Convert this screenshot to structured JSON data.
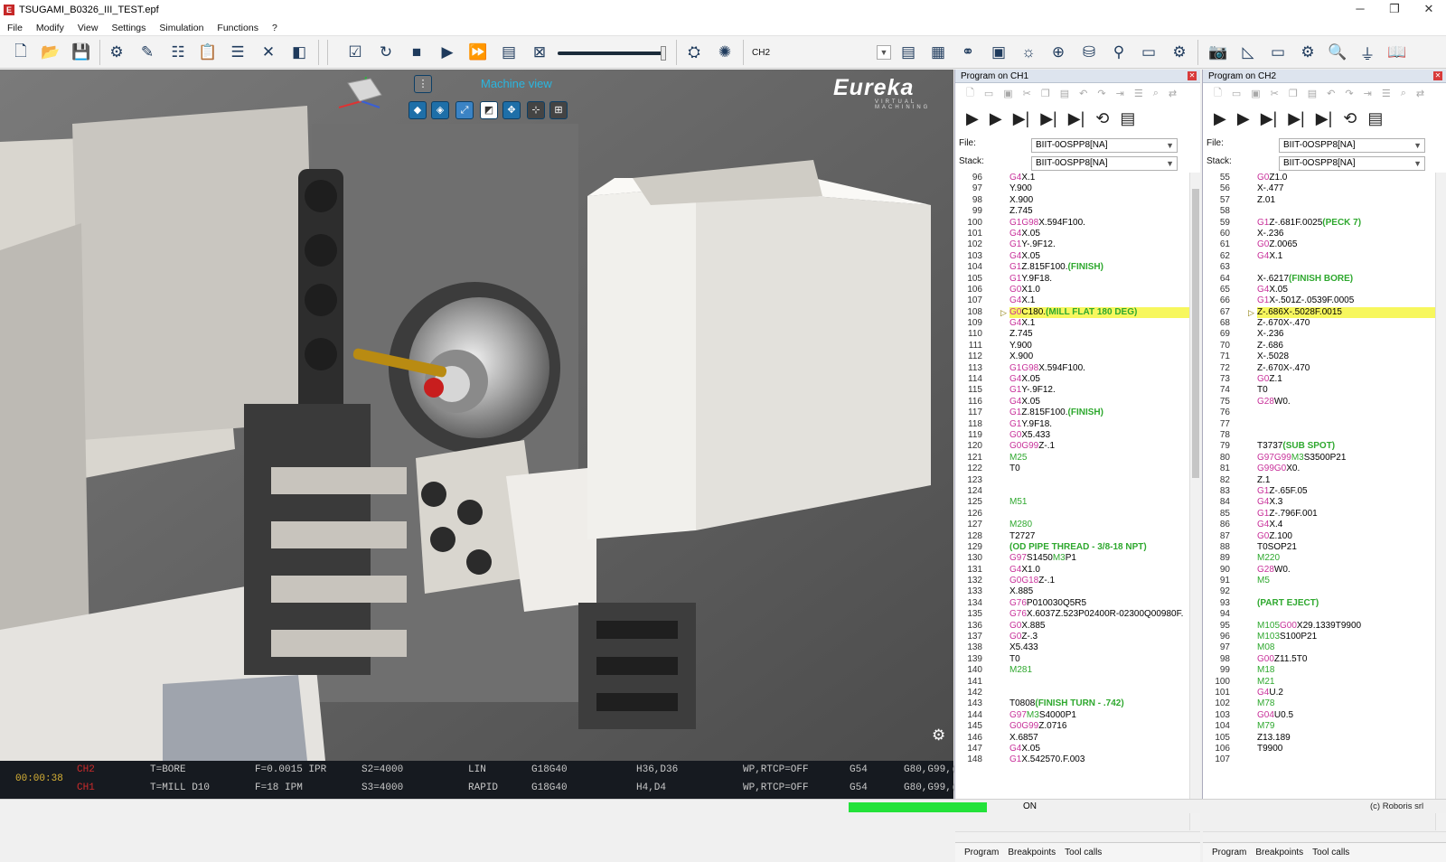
{
  "window": {
    "title": "TSUGAMI_B0326_III_TEST.epf",
    "controls": [
      "─",
      "❐",
      "✕"
    ]
  },
  "menu": [
    "File",
    "Modify",
    "View",
    "Settings",
    "Simulation",
    "Functions",
    "?"
  ],
  "toolbar": {
    "channel": "CH2"
  },
  "viewport": {
    "view_label": "Machine view",
    "brand": "Eureka",
    "brand_sub": "VIRTUAL MACHINING"
  },
  "status": {
    "time": "00:00:38",
    "rows": [
      {
        "ch": "CH2",
        "tool": "T=BORE",
        "feed": "F=0.0015 IPR",
        "speed": "S2=4000",
        "mode": "LIN",
        "g1": "G18G40",
        "hd": "H36,D36",
        "wp": "WP,RTCP=OFF",
        "wcs": "G54",
        "g2": "G80,G99,("
      },
      {
        "ch": "CH1",
        "tool": "T=MILL D10",
        "feed": "F=18 IPM",
        "speed": "S3=4000",
        "mode": "RAPID",
        "g1": "G18G40",
        "hd": "H4,D4",
        "wp": "WP,RTCP=OFF",
        "wcs": "G54",
        "g2": "G80,G99,("
      }
    ]
  },
  "panel1": {
    "title": "Program on CH1",
    "file_label": "File:",
    "stack_label": "Stack:",
    "file": "BIIT-0OSPP8[NA]",
    "stack": "BIIT-0OSPP8[NA]",
    "tabs": [
      "Program",
      "Breakpoints",
      "Tool calls"
    ],
    "lines": [
      {
        "n": "96",
        "s": [
          [
            "G4",
            "g"
          ],
          [
            "X.1",
            "n"
          ]
        ]
      },
      {
        "n": "97",
        "s": [
          [
            "Y.900",
            "n"
          ]
        ]
      },
      {
        "n": "98",
        "s": [
          [
            "X.900",
            "n"
          ]
        ]
      },
      {
        "n": "99",
        "s": [
          [
            "Z.745",
            "n"
          ]
        ]
      },
      {
        "n": "100",
        "s": [
          [
            "G1",
            "g"
          ],
          [
            "G98",
            "g"
          ],
          [
            "X.594F100.",
            "n"
          ]
        ]
      },
      {
        "n": "101",
        "s": [
          [
            "G4",
            "g"
          ],
          [
            "X.05",
            "n"
          ]
        ]
      },
      {
        "n": "102",
        "s": [
          [
            "G1",
            "g"
          ],
          [
            "Y-.9F12.",
            "n"
          ]
        ]
      },
      {
        "n": "103",
        "s": [
          [
            "G4",
            "g"
          ],
          [
            "X.05",
            "n"
          ]
        ]
      },
      {
        "n": "104",
        "s": [
          [
            "G1",
            "g"
          ],
          [
            "Z.815F100.",
            "n"
          ],
          [
            "(FINISH)",
            "c"
          ]
        ]
      },
      {
        "n": "105",
        "s": [
          [
            "G1",
            "g"
          ],
          [
            "Y.9F18.",
            "n"
          ]
        ]
      },
      {
        "n": "106",
        "s": [
          [
            "G0",
            "g"
          ],
          [
            "X1.0",
            "n"
          ]
        ]
      },
      {
        "n": "107",
        "s": [
          [
            "G4",
            "g"
          ],
          [
            "X.1",
            "n"
          ]
        ]
      },
      {
        "n": "108",
        "hl": true,
        "s": [
          [
            "G0",
            "g"
          ],
          [
            "C180.",
            "n"
          ],
          [
            "(MILL FLAT 180 DEG)",
            "c"
          ]
        ]
      },
      {
        "n": "109",
        "s": [
          [
            "G4",
            "g"
          ],
          [
            "X.1",
            "n"
          ]
        ]
      },
      {
        "n": "110",
        "s": [
          [
            "Z.745",
            "n"
          ]
        ]
      },
      {
        "n": "111",
        "s": [
          [
            "Y.900",
            "n"
          ]
        ]
      },
      {
        "n": "112",
        "s": [
          [
            "X.900",
            "n"
          ]
        ]
      },
      {
        "n": "113",
        "s": [
          [
            "G1",
            "g"
          ],
          [
            "G98",
            "g"
          ],
          [
            "X.594F100.",
            "n"
          ]
        ]
      },
      {
        "n": "114",
        "s": [
          [
            "G4",
            "g"
          ],
          [
            "X.05",
            "n"
          ]
        ]
      },
      {
        "n": "115",
        "s": [
          [
            "G1",
            "g"
          ],
          [
            "Y-.9F12.",
            "n"
          ]
        ]
      },
      {
        "n": "116",
        "s": [
          [
            "G4",
            "g"
          ],
          [
            "X.05",
            "n"
          ]
        ]
      },
      {
        "n": "117",
        "s": [
          [
            "G1",
            "g"
          ],
          [
            "Z.815F100.",
            "n"
          ],
          [
            "(FINISH)",
            "c"
          ]
        ]
      },
      {
        "n": "118",
        "s": [
          [
            "G1",
            "g"
          ],
          [
            "Y.9F18.",
            "n"
          ]
        ]
      },
      {
        "n": "119",
        "s": [
          [
            "G0",
            "g"
          ],
          [
            "X5.433",
            "n"
          ]
        ]
      },
      {
        "n": "120",
        "s": [
          [
            "G0",
            "g"
          ],
          [
            "G99",
            "g"
          ],
          [
            "Z-.1",
            "n"
          ]
        ]
      },
      {
        "n": "121",
        "s": [
          [
            "M25",
            "m"
          ]
        ]
      },
      {
        "n": "122",
        "s": [
          [
            "T0",
            "n"
          ]
        ]
      },
      {
        "n": "123",
        "s": []
      },
      {
        "n": "124",
        "s": []
      },
      {
        "n": "125",
        "s": [
          [
            "M51",
            "m"
          ]
        ]
      },
      {
        "n": "126",
        "s": []
      },
      {
        "n": "127",
        "s": [
          [
            "M280",
            "m"
          ]
        ]
      },
      {
        "n": "128",
        "s": [
          [
            "T2727",
            "n"
          ]
        ]
      },
      {
        "n": "129",
        "s": [
          [
            "(OD PIPE THREAD - 3/8-18 NPT)",
            "c"
          ]
        ]
      },
      {
        "n": "130",
        "s": [
          [
            "G97",
            "g"
          ],
          [
            "S1450",
            "n"
          ],
          [
            "M3",
            "m"
          ],
          [
            "P1",
            "n"
          ]
        ]
      },
      {
        "n": "131",
        "s": [
          [
            "G4",
            "g"
          ],
          [
            "X1.0",
            "n"
          ]
        ]
      },
      {
        "n": "132",
        "s": [
          [
            "G0",
            "g"
          ],
          [
            "G18",
            "g"
          ],
          [
            "Z-.1",
            "n"
          ]
        ]
      },
      {
        "n": "133",
        "s": [
          [
            "X.885",
            "n"
          ]
        ]
      },
      {
        "n": "134",
        "s": [
          [
            "G76",
            "g"
          ],
          [
            "P010030Q5R5",
            "n"
          ]
        ]
      },
      {
        "n": "135",
        "s": [
          [
            "G76",
            "g"
          ],
          [
            "X.6037Z.523P02400R-02300Q00980F.",
            "n"
          ]
        ]
      },
      {
        "n": "136",
        "s": [
          [
            "G0",
            "g"
          ],
          [
            "X.885",
            "n"
          ]
        ]
      },
      {
        "n": "137",
        "s": [
          [
            "G0",
            "g"
          ],
          [
            "Z-.3",
            "n"
          ]
        ]
      },
      {
        "n": "138",
        "s": [
          [
            "X5.433",
            "n"
          ]
        ]
      },
      {
        "n": "139",
        "s": [
          [
            "T0",
            "n"
          ]
        ]
      },
      {
        "n": "140",
        "s": [
          [
            "M281",
            "m"
          ]
        ]
      },
      {
        "n": "141",
        "s": []
      },
      {
        "n": "142",
        "s": []
      },
      {
        "n": "143",
        "s": [
          [
            "T0808",
            "n"
          ],
          [
            "(FINISH TURN - .742)",
            "c"
          ]
        ]
      },
      {
        "n": "144",
        "s": [
          [
            "G97",
            "g"
          ],
          [
            "M3",
            "m"
          ],
          [
            "S4000P1",
            "n"
          ]
        ]
      },
      {
        "n": "145",
        "s": [
          [
            "G0",
            "g"
          ],
          [
            "G99",
            "g"
          ],
          [
            "Z.0716",
            "n"
          ]
        ]
      },
      {
        "n": "146",
        "s": [
          [
            "X.6857",
            "n"
          ]
        ]
      },
      {
        "n": "147",
        "s": [
          [
            "G4",
            "g"
          ],
          [
            "X.05",
            "n"
          ]
        ]
      },
      {
        "n": "148",
        "s": [
          [
            "G1",
            "g"
          ],
          [
            "X.542570.F.003",
            "n"
          ]
        ]
      }
    ]
  },
  "panel2": {
    "title": "Program on CH2",
    "file_label": "File:",
    "stack_label": "Stack:",
    "file": "BIIT-0OSPP8[NA]",
    "stack": "BIIT-0OSPP8[NA]",
    "tabs": [
      "Program",
      "Breakpoints",
      "Tool calls"
    ],
    "lines": [
      {
        "n": "55",
        "s": [
          [
            "G0",
            "g"
          ],
          [
            "Z1.0",
            "n"
          ]
        ]
      },
      {
        "n": "56",
        "s": [
          [
            "X-.477",
            "n"
          ]
        ]
      },
      {
        "n": "57",
        "s": [
          [
            "Z.01",
            "n"
          ]
        ]
      },
      {
        "n": "58",
        "s": []
      },
      {
        "n": "59",
        "s": [
          [
            "G1",
            "g"
          ],
          [
            "Z-.681F.0025",
            "n"
          ],
          [
            "(PECK 7)",
            "c"
          ]
        ]
      },
      {
        "n": "60",
        "s": [
          [
            "X-.236",
            "n"
          ]
        ]
      },
      {
        "n": "61",
        "s": [
          [
            "G0",
            "g"
          ],
          [
            "Z.0065",
            "n"
          ]
        ]
      },
      {
        "n": "62",
        "s": [
          [
            "G4",
            "g"
          ],
          [
            "X.1",
            "n"
          ]
        ]
      },
      {
        "n": "63",
        "s": []
      },
      {
        "n": "64",
        "s": [
          [
            "X-.6217",
            "n"
          ],
          [
            "(FINISH BORE)",
            "c"
          ]
        ]
      },
      {
        "n": "65",
        "s": [
          [
            "G4",
            "g"
          ],
          [
            "X.05",
            "n"
          ]
        ]
      },
      {
        "n": "66",
        "s": [
          [
            "G1",
            "g"
          ],
          [
            "X-.501Z-.0539F.0005",
            "n"
          ]
        ]
      },
      {
        "n": "67",
        "hl": true,
        "s": [
          [
            "Z-.686X-.5028F.0015",
            "n"
          ]
        ]
      },
      {
        "n": "68",
        "s": [
          [
            "Z-.670X-.470",
            "n"
          ]
        ]
      },
      {
        "n": "69",
        "s": [
          [
            "X-.236",
            "n"
          ]
        ]
      },
      {
        "n": "70",
        "s": [
          [
            "Z-.686",
            "n"
          ]
        ]
      },
      {
        "n": "71",
        "s": [
          [
            "X-.5028",
            "n"
          ]
        ]
      },
      {
        "n": "72",
        "s": [
          [
            "Z-.670X-.470",
            "n"
          ]
        ]
      },
      {
        "n": "73",
        "s": [
          [
            "G0",
            "g"
          ],
          [
            "Z.1",
            "n"
          ]
        ]
      },
      {
        "n": "74",
        "s": [
          [
            "T0",
            "n"
          ]
        ]
      },
      {
        "n": "75",
        "s": [
          [
            "G28",
            "g"
          ],
          [
            "W0.",
            "n"
          ]
        ]
      },
      {
        "n": "76",
        "s": []
      },
      {
        "n": "77",
        "s": []
      },
      {
        "n": "78",
        "s": []
      },
      {
        "n": "79",
        "s": [
          [
            "T3737",
            "n"
          ],
          [
            "(SUB SPOT)",
            "c"
          ]
        ]
      },
      {
        "n": "80",
        "s": [
          [
            "G97",
            "g"
          ],
          [
            "G99",
            "g"
          ],
          [
            "M3",
            "m"
          ],
          [
            "S3500P21",
            "n"
          ]
        ]
      },
      {
        "n": "81",
        "s": [
          [
            "G99",
            "g"
          ],
          [
            "G0",
            "g"
          ],
          [
            "X0.",
            "n"
          ]
        ]
      },
      {
        "n": "82",
        "s": [
          [
            "Z.1",
            "n"
          ]
        ]
      },
      {
        "n": "83",
        "s": [
          [
            "G1",
            "g"
          ],
          [
            "Z-.65F.05",
            "n"
          ]
        ]
      },
      {
        "n": "84",
        "s": [
          [
            "G4",
            "g"
          ],
          [
            "X.3",
            "n"
          ]
        ]
      },
      {
        "n": "85",
        "s": [
          [
            "G1",
            "g"
          ],
          [
            "Z-.796F.001",
            "n"
          ]
        ]
      },
      {
        "n": "86",
        "s": [
          [
            "G4",
            "g"
          ],
          [
            "X.4",
            "n"
          ]
        ]
      },
      {
        "n": "87",
        "s": [
          [
            "G0",
            "g"
          ],
          [
            "Z.100",
            "n"
          ]
        ]
      },
      {
        "n": "88",
        "s": [
          [
            "T0SOP21",
            "n"
          ]
        ]
      },
      {
        "n": "89",
        "s": [
          [
            "M220",
            "m"
          ]
        ]
      },
      {
        "n": "90",
        "s": [
          [
            "G28",
            "g"
          ],
          [
            "W0.",
            "n"
          ]
        ]
      },
      {
        "n": "91",
        "s": [
          [
            "M5",
            "m"
          ]
        ]
      },
      {
        "n": "92",
        "s": []
      },
      {
        "n": "93",
        "s": [
          [
            "(PART EJECT)",
            "c"
          ]
        ]
      },
      {
        "n": "94",
        "s": []
      },
      {
        "n": "95",
        "s": [
          [
            "M105",
            "m"
          ],
          [
            "G00",
            "g"
          ],
          [
            "X29.1339T9900",
            "n"
          ]
        ]
      },
      {
        "n": "96",
        "s": [
          [
            "M103",
            "m"
          ],
          [
            "S100P21",
            "n"
          ]
        ]
      },
      {
        "n": "97",
        "s": [
          [
            "M08",
            "m"
          ]
        ]
      },
      {
        "n": "98",
        "s": [
          [
            "G00",
            "g"
          ],
          [
            "Z11.5T0",
            "n"
          ]
        ]
      },
      {
        "n": "99",
        "s": [
          [
            "M18",
            "m"
          ]
        ]
      },
      {
        "n": "100",
        "s": [
          [
            "M21",
            "m"
          ]
        ]
      },
      {
        "n": "101",
        "s": [
          [
            "G4",
            "g"
          ],
          [
            "U.2",
            "n"
          ]
        ]
      },
      {
        "n": "102",
        "s": [
          [
            "M78",
            "m"
          ]
        ]
      },
      {
        "n": "103",
        "s": [
          [
            "G04",
            "g"
          ],
          [
            "U0.5",
            "n"
          ]
        ]
      },
      {
        "n": "104",
        "s": [
          [
            "M79",
            "m"
          ]
        ]
      },
      {
        "n": "105",
        "s": [
          [
            "Z13.189",
            "n"
          ]
        ]
      },
      {
        "n": "106",
        "s": [
          [
            "T9900",
            "n"
          ]
        ]
      },
      {
        "n": "107",
        "s": []
      }
    ]
  },
  "bottom": {
    "status": "ON",
    "copyright": "(c) Roboris srl"
  }
}
